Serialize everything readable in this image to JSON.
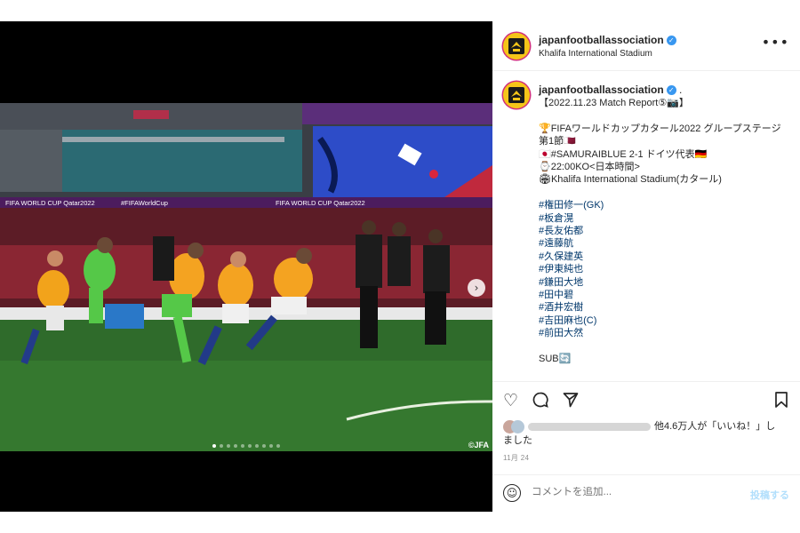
{
  "post": {
    "username": "japanfootballassociation",
    "location": "Khalifa International Stadium",
    "verified_mark": "✓",
    "more_icon": "•••"
  },
  "caption": {
    "username": "japanfootballassociation",
    "dot": ".",
    "lines": [
      {
        "text": "【2022.11.23 Match Report⑤📷】"
      },
      {
        "text": ""
      },
      {
        "text": "🏆FIFAワールドカップカタール2022 グループステージ第1節🇶🇦",
        "wrap": true
      },
      {
        "text": "🇯🇵#SAMURAIBLUE 2-1 ドイツ代表🇩🇪"
      },
      {
        "text": "⌚22:00KO<日本時間>"
      },
      {
        "text": "🏟Khalifa International Stadium(カタール)"
      },
      {
        "text": ""
      },
      {
        "text": "#権田修一(GK)",
        "tag": true
      },
      {
        "text": "#板倉滉",
        "tag": true
      },
      {
        "text": "#長友佑都",
        "tag": true
      },
      {
        "text": "#遠藤航",
        "tag": true
      },
      {
        "text": "#久保建英",
        "tag": true
      },
      {
        "text": "#伊東純也",
        "tag": true
      },
      {
        "text": "#鎌田大地",
        "tag": true
      },
      {
        "text": "#田中碧",
        "tag": true
      },
      {
        "text": "#酒井宏樹",
        "tag": true
      },
      {
        "text": "#吉田麻也(C)",
        "tag": true
      },
      {
        "text": "#前田大然",
        "tag": true
      },
      {
        "text": ""
      },
      {
        "text": "SUB🔄"
      }
    ]
  },
  "photo": {
    "credit": "©JFA",
    "banner_left": "FIFA WORLD CUP Qatar2022",
    "banner_right": "#FIFAWorldCup",
    "carousel_count": 10,
    "carousel_active": 0
  },
  "actions": {
    "like_icon": "heart-icon",
    "comment_icon": "comment-icon",
    "share_icon": "send-icon",
    "save_icon": "bookmark-icon"
  },
  "likes": {
    "line1": "他4.6万人が「いいね！」し",
    "line2": "ました"
  },
  "date": "11月 24",
  "comment": {
    "placeholder": "コメントを追加...",
    "post_label": "投稿する"
  }
}
